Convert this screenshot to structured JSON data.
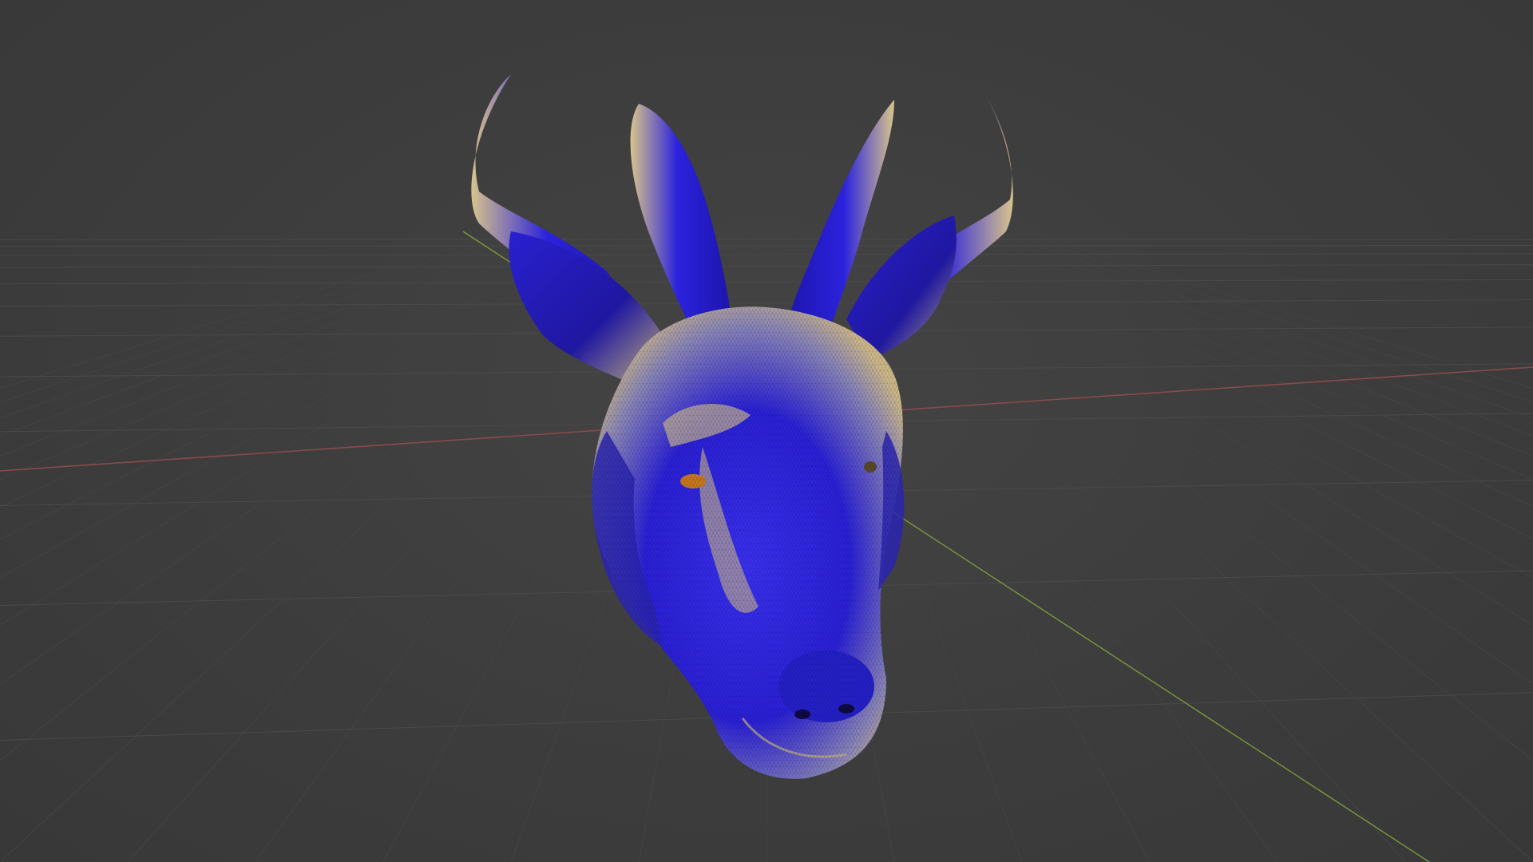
{
  "viewport": {
    "mode": "3d-viewport",
    "background_color": "#3d3d3d",
    "grid_color": "#4a4a4a",
    "x_axis_color": "#8a4a4a",
    "y_axis_color": "#7a9a3a"
  },
  "model": {
    "name": "goat-head-sculpt",
    "base_color": "#2a1fd6",
    "highlight_color": "#e6c57a",
    "wireframe_overlay": true,
    "eye_color": "#c8781e"
  }
}
